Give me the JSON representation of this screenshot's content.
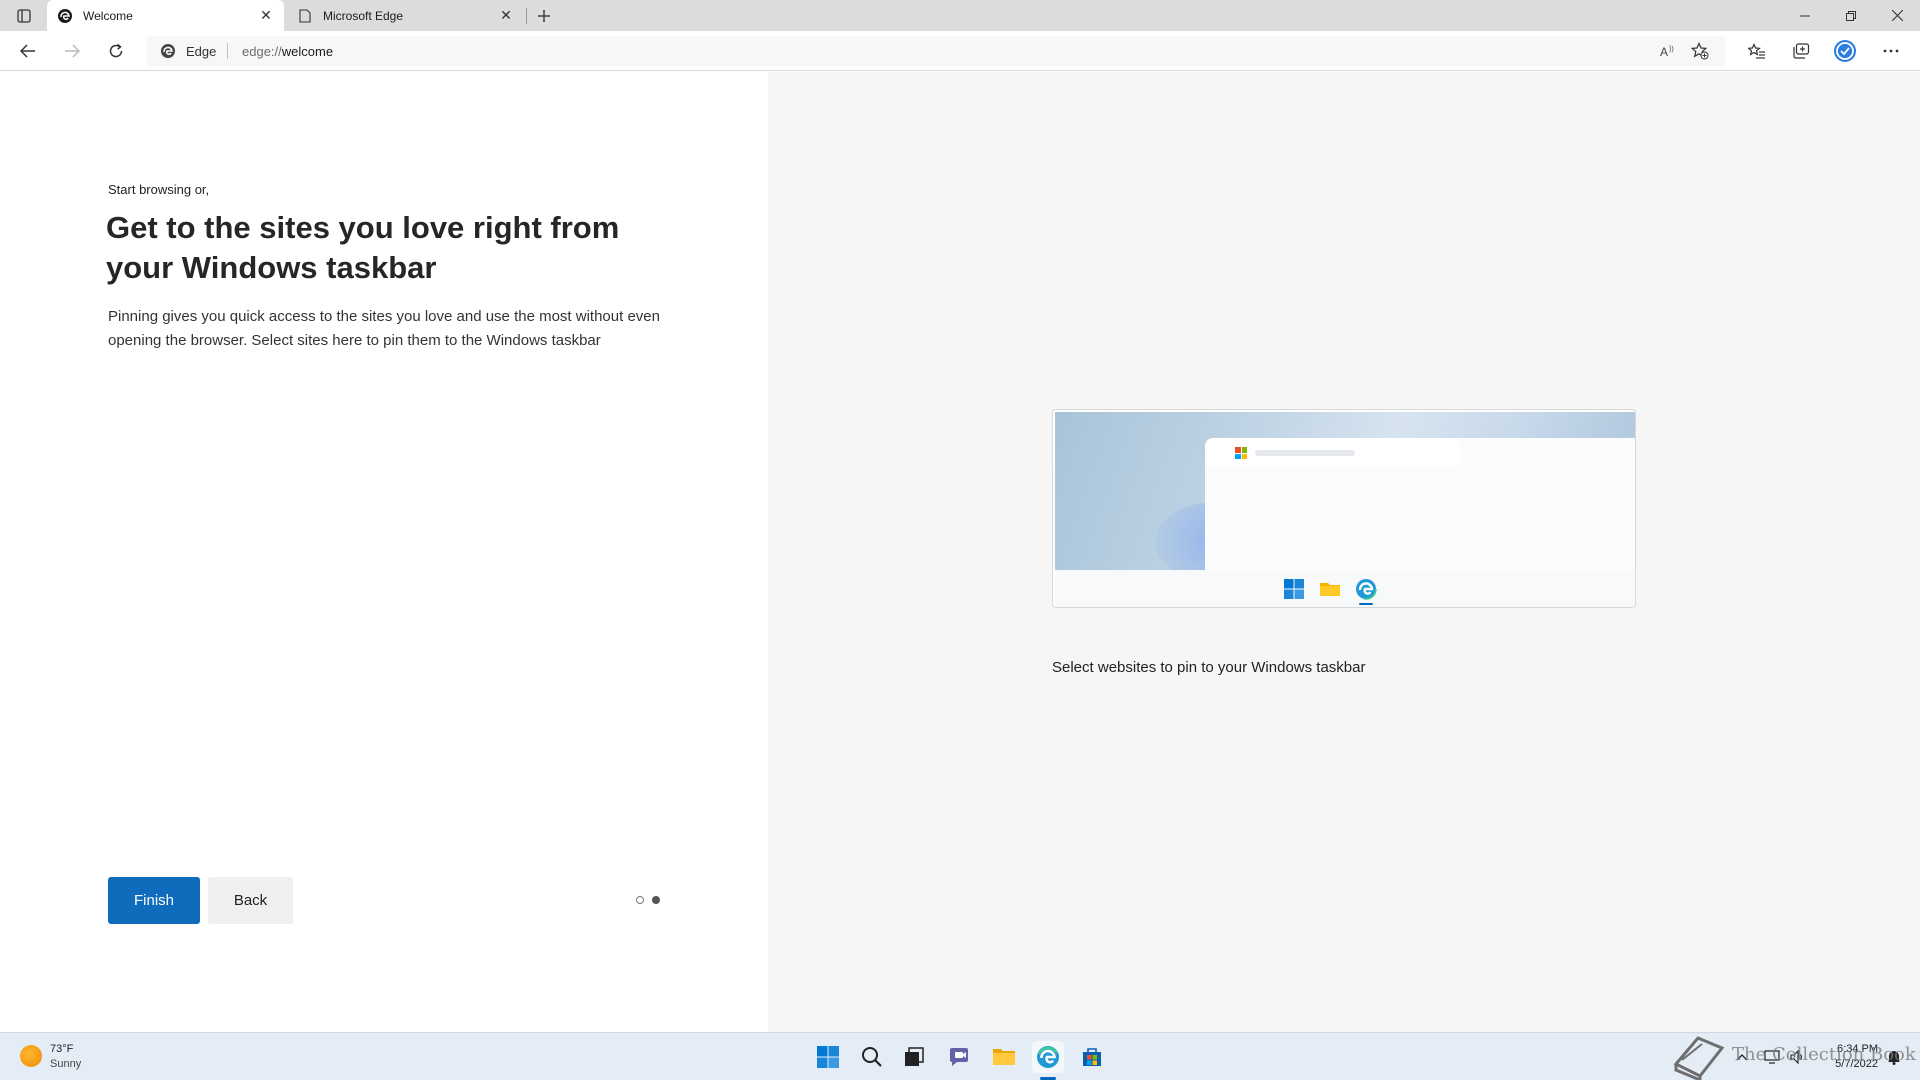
{
  "tabs": [
    {
      "title": "Welcome",
      "active": true
    },
    {
      "title": "Microsoft Edge",
      "active": false
    }
  ],
  "address": {
    "site_label": "Edge",
    "url_prefix": "edge://",
    "url_path": "welcome"
  },
  "content": {
    "eyebrow": "Start browsing or,",
    "headline": "Get to the sites you love right from your Windows taskbar",
    "description": "Pinning gives you quick access to the sites you love and use the most without even opening the browser. Select sites here to pin them to the Windows taskbar",
    "finish_label": "Finish",
    "back_label": "Back",
    "caption": "Select websites to pin to your Windows taskbar"
  },
  "taskbar": {
    "weather_temp": "73°F",
    "weather_condition": "Sunny",
    "time": "6:34 PM",
    "date": "5/7/2022"
  },
  "watermark_text": "The Collection Book",
  "colors": {
    "accent": "#0f6cbd",
    "right_pane_bg": "#f6f6f6",
    "tabstrip_bg": "#dcdcdc",
    "taskbar_bg": "#e4ecf6"
  }
}
